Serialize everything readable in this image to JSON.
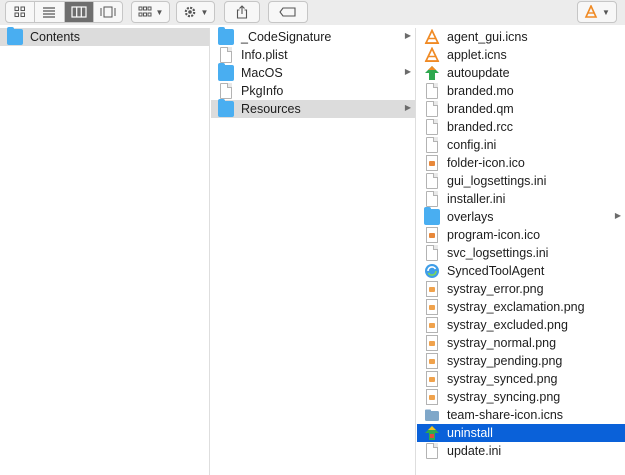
{
  "toolbar": {
    "view_buttons": [
      "icon-view",
      "list-view",
      "column-view",
      "gallery-view"
    ],
    "active_view": "column-view"
  },
  "column1": {
    "items": [
      {
        "label": "Contents",
        "icon": "folder-icon",
        "has_children": false,
        "selected": "gray"
      }
    ]
  },
  "column2": {
    "items": [
      {
        "label": "_CodeSignature",
        "icon": "folder-icon",
        "has_children": true
      },
      {
        "label": "Info.plist",
        "icon": "document-icon",
        "has_children": false
      },
      {
        "label": "MacOS",
        "icon": "folder-icon",
        "has_children": true
      },
      {
        "label": "PkgInfo",
        "icon": "document-icon",
        "has_children": false
      },
      {
        "label": "Resources",
        "icon": "folder-icon",
        "has_children": true,
        "selected": "gray"
      }
    ]
  },
  "column3": {
    "items": [
      {
        "label": "agent_gui.icns",
        "icon": "cone-icon"
      },
      {
        "label": "applet.icns",
        "icon": "cone-icon"
      },
      {
        "label": "autoupdate",
        "icon": "autoupdate-icon"
      },
      {
        "label": "branded.mo",
        "icon": "document-icon"
      },
      {
        "label": "branded.qm",
        "icon": "document-icon"
      },
      {
        "label": "branded.rcc",
        "icon": "document-icon"
      },
      {
        "label": "config.ini",
        "icon": "document-icon"
      },
      {
        "label": "folder-icon.ico",
        "icon": "image-icon"
      },
      {
        "label": "gui_logsettings.ini",
        "icon": "document-icon"
      },
      {
        "label": "installer.ini",
        "icon": "document-icon"
      },
      {
        "label": "overlays",
        "icon": "folder-icon",
        "has_children": true
      },
      {
        "label": "program-icon.ico",
        "icon": "image-icon"
      },
      {
        "label": "svc_logsettings.ini",
        "icon": "document-icon"
      },
      {
        "label": "SyncedToolAgent",
        "icon": "sync-icon"
      },
      {
        "label": "systray_error.png",
        "icon": "image-icon"
      },
      {
        "label": "systray_exclamation.png",
        "icon": "image-icon"
      },
      {
        "label": "systray_excluded.png",
        "icon": "image-icon"
      },
      {
        "label": "systray_normal.png",
        "icon": "image-icon"
      },
      {
        "label": "systray_pending.png",
        "icon": "image-icon"
      },
      {
        "label": "systray_synced.png",
        "icon": "image-icon"
      },
      {
        "label": "systray_syncing.png",
        "icon": "image-icon"
      },
      {
        "label": "team-share-icon.icns",
        "icon": "icns-icon"
      },
      {
        "label": "uninstall",
        "icon": "uninstall-icon",
        "selected": "blue"
      },
      {
        "label": "update.ini",
        "icon": "document-icon"
      }
    ]
  },
  "colors": {
    "selection_blue": "#0a61d9",
    "selection_gray": "#dcdcdc",
    "folder_blue": "#49aef1",
    "cone_orange": "#f08a24"
  }
}
